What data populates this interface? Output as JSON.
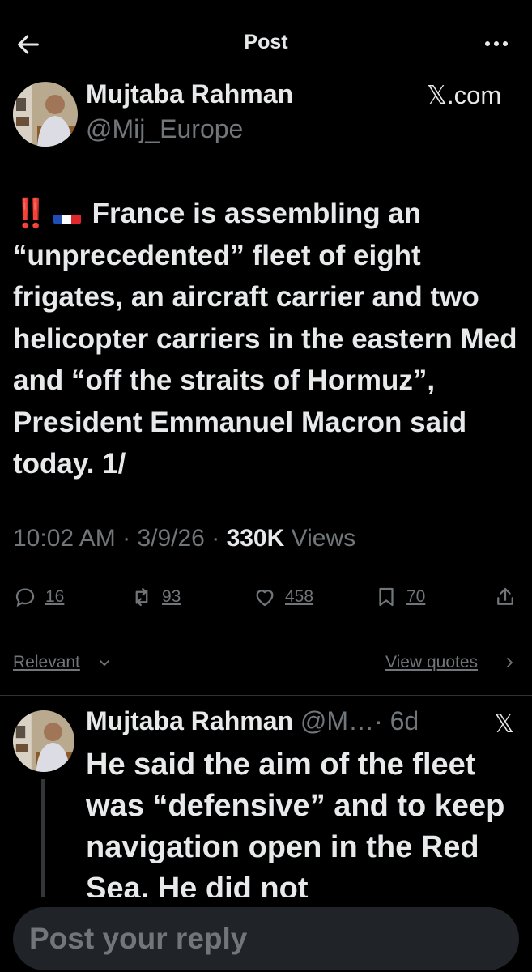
{
  "header": {
    "title": "Post"
  },
  "author": {
    "name": "Mujtaba Rahman",
    "handle": "@Mij_Europe",
    "source": "𝕏.com"
  },
  "post": {
    "alert": "‼️",
    "text": "France is assembling an “unprecedented” fleet of eight frigates, an aircraft carrier and two helicopter carriers in the eastern Med and “off the straits of Hormuz”, President Emmanuel Macron said today.  1/",
    "time": "10:02 AM",
    "date": "3/9/26",
    "views_count": "330K",
    "views_label": "Views",
    "sep": "·"
  },
  "actions": {
    "replies": "16",
    "reposts": "93",
    "likes": "458",
    "bookmarks": "70"
  },
  "filters": {
    "sort": "Relevant",
    "quotes": "View quotes"
  },
  "reply": {
    "name": "Mujtaba Rahman",
    "handle": "@M…",
    "age": "· 6d",
    "source": "𝕏",
    "text": "He said the aim of the fleet was “defensive” and to keep navigation open in the Red Sea. He did not"
  },
  "composer": {
    "placeholder": "Post your reply"
  },
  "colors": {
    "background": "#000000",
    "text": "#e7e9ea",
    "muted": "#71767b",
    "composer": "#202327",
    "alert": "#f4212e"
  },
  "icons": [
    "back-arrow-icon",
    "more-icon",
    "reply-icon",
    "repost-icon",
    "like-icon",
    "bookmark-icon",
    "share-icon",
    "chevron-down-icon",
    "chevron-right-icon"
  ]
}
